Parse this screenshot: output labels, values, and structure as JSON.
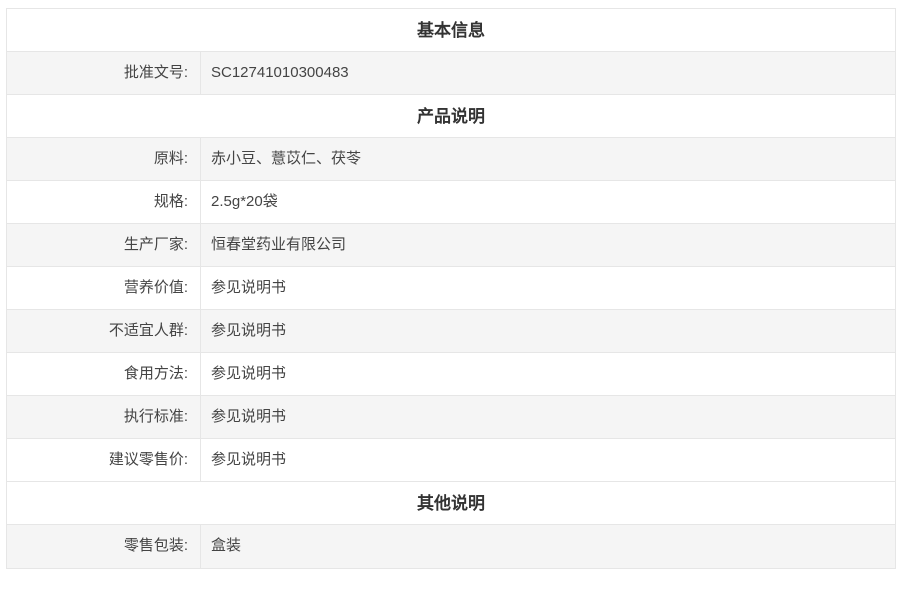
{
  "sections": [
    {
      "title": "基本信息",
      "rows": [
        {
          "label": "批准文号:",
          "value": "SC12741010300483"
        }
      ]
    },
    {
      "title": "产品说明",
      "rows": [
        {
          "label": "原料:",
          "value": "赤小豆、薏苡仁、茯苓"
        },
        {
          "label": "规格:",
          "value": "2.5g*20袋"
        },
        {
          "label": "生产厂家:",
          "value": "恒春堂药业有限公司"
        },
        {
          "label": "营养价值:",
          "value": "参见说明书"
        },
        {
          "label": "不适宜人群:",
          "value": "参见说明书"
        },
        {
          "label": "食用方法:",
          "value": "参见说明书"
        },
        {
          "label": "执行标准:",
          "value": "参见说明书"
        },
        {
          "label": "建议零售价:",
          "value": "参见说明书"
        }
      ]
    },
    {
      "title": "其他说明",
      "rows": [
        {
          "label": "零售包装:",
          "value": "盒装"
        }
      ]
    }
  ]
}
